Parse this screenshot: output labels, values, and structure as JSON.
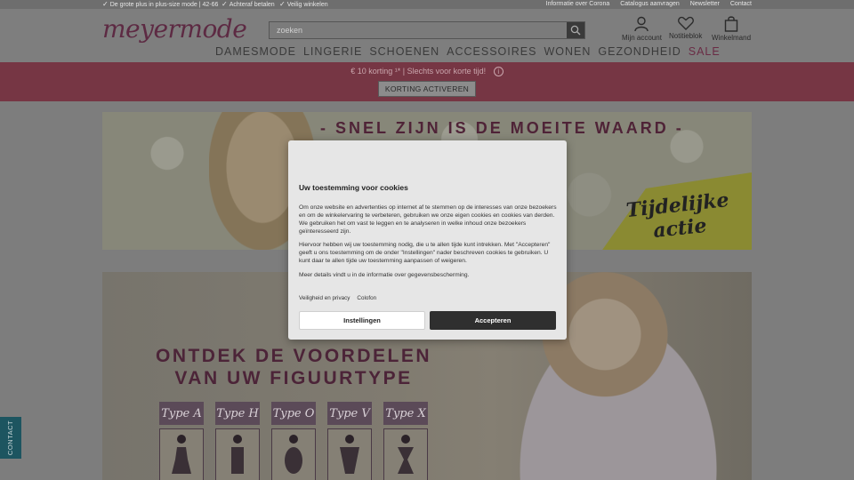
{
  "topbar": {
    "usps": [
      "De grote plus in plus-size mode | 42-66",
      "Achteraf betalen",
      "Veilig winkelen"
    ],
    "links": [
      "Informatie over Corona",
      "Catalogus aanvragen",
      "Newsletter",
      "Contact"
    ]
  },
  "header": {
    "logo": "meyermode",
    "search_placeholder": "zoeken",
    "account_label": "Mijn account",
    "wishlist_label": "Notitieblok",
    "cart_label": "Winkelmand"
  },
  "nav": {
    "items": [
      "DAMESMODE",
      "LINGERIE",
      "SCHOENEN",
      "ACCESSOIRES",
      "WONEN",
      "GEZONDHEID",
      "SALE"
    ]
  },
  "promo": {
    "text": "€ 10 korting  ¹* | Slechts voor korte tijd!",
    "button_label": "KORTING ACTIVEREN"
  },
  "banner1": {
    "title": "- SNEL ZIJN IS DE MOEITE WAARD -",
    "badge_line1": "Tijdelijke",
    "badge_line2": "actie"
  },
  "banner2": {
    "title_line1": "ONTDEK DE VOORDELEN",
    "title_line2": "VAN UW FIGUURTYPE",
    "types": [
      "Type A",
      "Type H",
      "Type O",
      "Type V",
      "Type X"
    ]
  },
  "contact_tab": "CONTACT",
  "cookie": {
    "title": "Uw toestemming voor cookies",
    "p1": "Om onze website en advertenties op internet af te stemmen op de interesses van onze bezoekers en om de winkelervaring te verbeteren, gebruiken we onze eigen cookies en cookies van derden. We gebruiken het om vast te leggen en te analyseren in welke inhoud onze bezoekers geïnteresseerd zijn.",
    "p2": "Hiervoor hebben wij uw toestemming nodig, die u te allen tijde kunt intrekken. Met \"Accepteren\" geeft u ons toestemming om de onder \"Instellingen\" nader beschreven cookies te gebruiken. U kunt daar te allen tijde uw toestemming aanpassen of weigeren.",
    "p3": "Meer details vindt u in de informatie over gegevensbescherming.",
    "link_privacy": "Veiligheid en privacy",
    "link_colofon": "Colofon",
    "settings_label": "Instellingen",
    "accept_label": "Accepteren"
  },
  "colors": {
    "brand": "#5d2a43",
    "promo_band": "#763644",
    "accept_button": "#2f2f2f",
    "contact_tab": "#1d5560"
  }
}
